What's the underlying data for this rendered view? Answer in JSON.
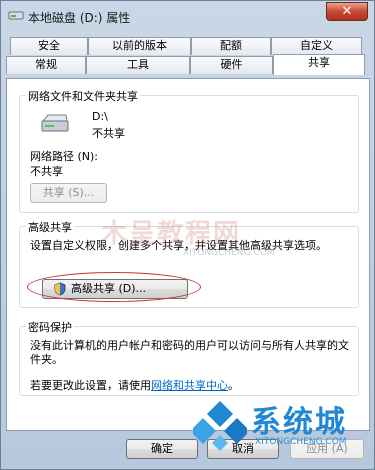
{
  "window": {
    "title": "本地磁盘 (D:) 属性",
    "close_label": "✕"
  },
  "tabs_row1": [
    "安全",
    "以前的版本",
    "配额",
    "自定义"
  ],
  "tabs_row2": [
    "常规",
    "工具",
    "硬件",
    "共享"
  ],
  "active_tab": "共享",
  "network_share": {
    "group_title": "网络文件和文件夹共享",
    "drive_name": "D:\\",
    "drive_status": "不共享",
    "path_label": "网络路径 (N):",
    "path_value": "不共享",
    "share_button": "共享 (S)..."
  },
  "advanced_share": {
    "group_title": "高级共享",
    "description": "设置自定义权限，创建多个共享，并设置其他高级共享选项。",
    "button": "高级共享 (D)..."
  },
  "password": {
    "group_title": "密码保护",
    "description": "没有此计算机的用户帐户和密码的用户可以访问与所有人共享的文件夹。",
    "change_prefix": "若要更改此设置，请使用",
    "link": "网络和共享中心",
    "change_suffix": "。"
  },
  "footer": {
    "ok": "确定",
    "cancel": "取消",
    "apply": "应用 (A)"
  },
  "watermarks": {
    "big": "木呈教程网",
    "small": "XITONGCHENG.COM",
    "brand": "系统城",
    "brand_url": "XITONGCHENG.COM"
  },
  "colors": {
    "link": "#0066cc",
    "close_button": "#c74a35",
    "brand": "#1f87d3"
  }
}
